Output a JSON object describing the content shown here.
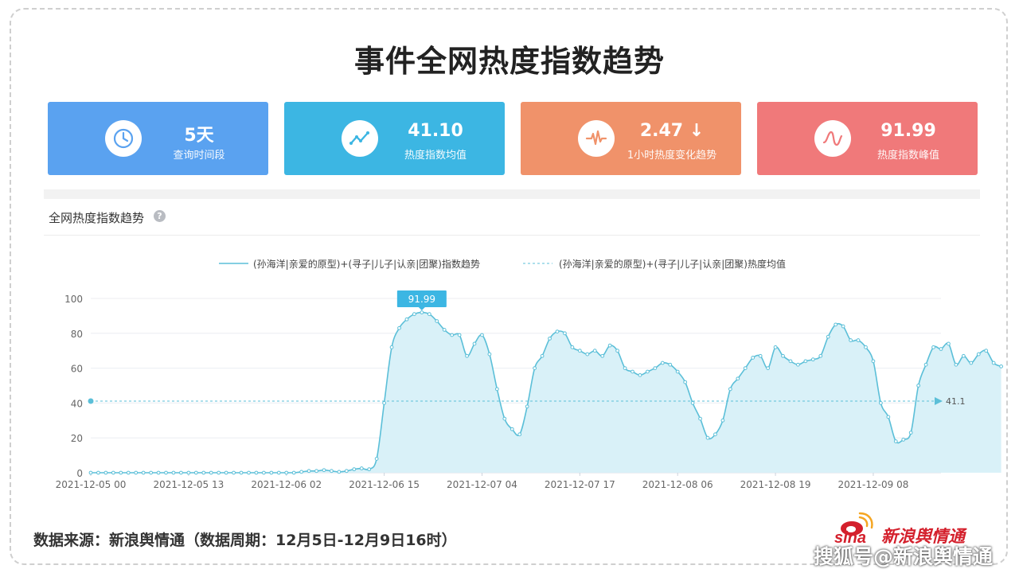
{
  "title": "事件全网热度指数趋势",
  "cards": [
    {
      "value": "5天",
      "label": "查询时间段",
      "icon": "clock-icon",
      "color": "#5aa2f0"
    },
    {
      "value": "41.10",
      "label": "热度指数均值",
      "icon": "trend-line-icon",
      "color": "#3cb6e3"
    },
    {
      "value": "2.47 ↓",
      "label": "1小时热度变化趋势",
      "icon": "pulse-icon",
      "color": "#f0926a"
    },
    {
      "value": "91.99",
      "label": "热度指数峰值",
      "icon": "wave-icon",
      "color": "#f0797a"
    }
  ],
  "section": {
    "title": "全网热度指数趋势"
  },
  "chart_data": {
    "type": "area",
    "series": [
      {
        "name": "(孙海洋|亲爱的原型)+(寻子|儿子|认亲|团聚)指数趋势",
        "color": "#5bbfd8"
      },
      {
        "name": "(孙海洋|亲爱的原型)+(寻子|儿子|认亲|团聚)热度均值",
        "color": "#5bbfd8"
      }
    ],
    "y_ticks": [
      "0",
      "20",
      "40",
      "60",
      "80",
      "100"
    ],
    "ylim": [
      0,
      100
    ],
    "x_ticks": [
      "2021-12-05 00",
      "2021-12-05 13",
      "2021-12-06 02",
      "2021-12-06 15",
      "2021-12-07 04",
      "2021-12-07 17",
      "2021-12-08 06",
      "2021-12-08 19",
      "2021-12-09 08"
    ],
    "x_tick_hours": [
      0,
      13,
      26,
      39,
      52,
      65,
      78,
      91,
      104
    ],
    "x_max_hour": 113,
    "values": [
      0,
      0,
      0,
      0,
      0,
      0,
      0,
      0,
      0,
      0,
      0,
      0,
      0,
      0,
      0,
      0,
      0,
      0,
      0,
      0,
      0,
      0,
      0,
      0,
      0,
      0,
      0,
      0,
      0.5,
      1,
      1,
      1.5,
      1,
      0.5,
      1,
      2,
      2.5,
      2,
      8,
      40,
      72,
      83,
      88,
      91,
      91.99,
      91,
      87,
      82,
      79,
      79,
      67,
      74,
      79,
      68,
      48,
      31,
      25,
      22,
      38,
      60,
      67,
      77,
      81,
      80,
      72,
      70,
      68,
      70,
      67,
      73,
      70,
      60,
      58,
      56,
      58,
      60,
      63,
      62,
      58,
      52,
      40,
      31,
      20,
      22,
      30,
      48,
      54,
      60,
      66,
      67,
      60,
      72,
      67,
      64,
      62,
      64,
      65,
      67,
      78,
      85,
      84,
      76,
      76,
      72,
      64,
      40,
      32,
      18,
      19,
      23,
      50,
      62,
      72,
      71,
      74,
      62,
      67,
      63,
      68,
      70,
      63,
      61
    ],
    "average": 41.1,
    "average_label": "41.1",
    "peak_label": "91.99",
    "peak_index": 44,
    "grid": "horizontal",
    "legend": "top-center"
  },
  "footer": {
    "source": "数据来源：新浪舆情通（数据周期：12月5日-12月9日16时）",
    "brand_logo": "sina",
    "brand_name": "新浪舆情通",
    "watermark": "搜狐号@新浪舆情通"
  }
}
